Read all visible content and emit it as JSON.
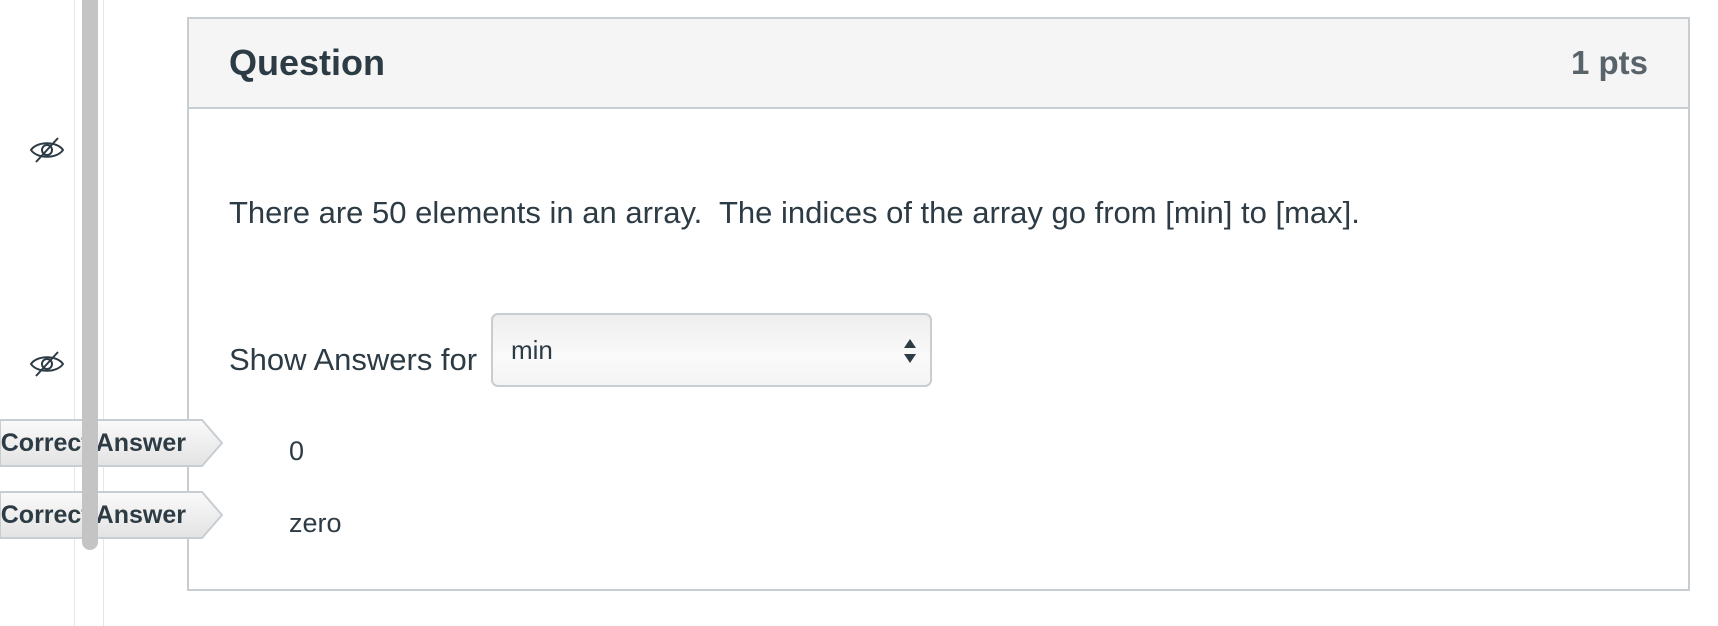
{
  "question": {
    "title": "Question",
    "points": "1 pts",
    "text": "There are 50 elements in an array.  The indices of the array go from [min] to [max]."
  },
  "answer_selector": {
    "label": "Show Answers for",
    "selected": "min"
  },
  "correct_answers": [
    {
      "flag_label": "Correct Answer",
      "value": "0"
    },
    {
      "flag_label": "Correct Answer",
      "value": "zero"
    }
  ],
  "icons": {
    "hidden_eye_1": "eye-slash-icon",
    "hidden_eye_2": "eye-slash-icon",
    "select_arrows": "sort-arrows-icon"
  },
  "colors": {
    "text": "#2d3b45",
    "header_bg": "#f5f5f5",
    "border": "#c7cdd1",
    "scrollbar": "#c4c4c4"
  }
}
